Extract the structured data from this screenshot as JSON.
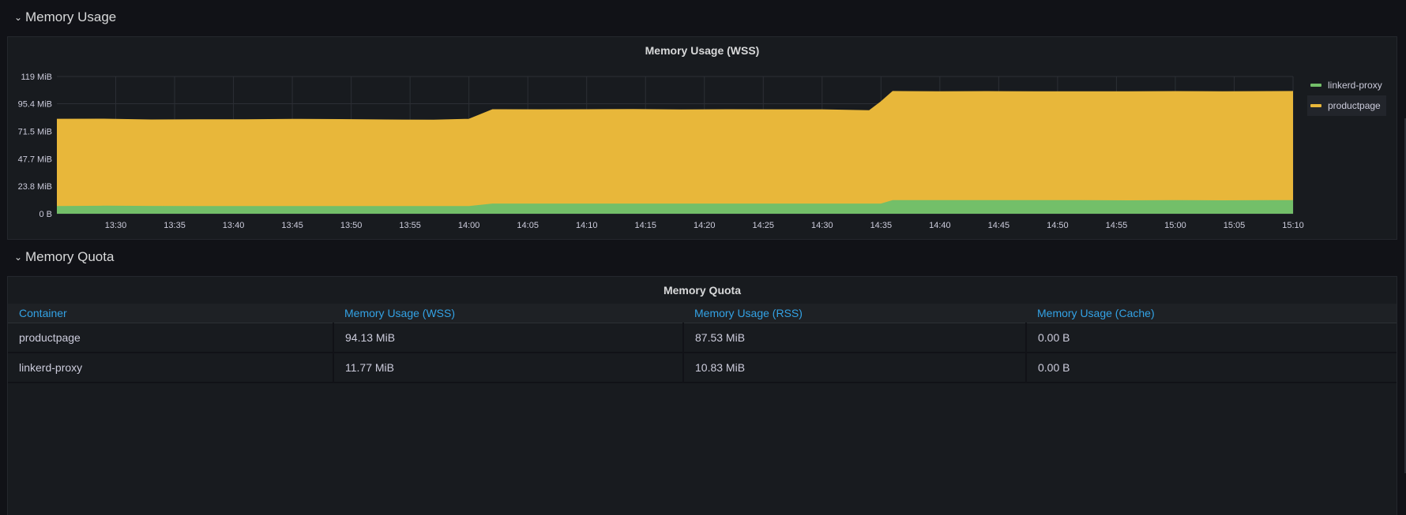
{
  "rows": {
    "memory_usage": {
      "title": "Memory Usage"
    },
    "memory_quota": {
      "title": "Memory Quota"
    }
  },
  "icons": {
    "collapse": "chevron-down-icon"
  },
  "colors": {
    "background": "#111217",
    "panel": "#181b1f",
    "linkerd_proxy": "#73bf69",
    "productpage": "#e8b73a",
    "header_link": "#33a2e5"
  },
  "chart_panel": {
    "title": "Memory Usage (WSS)"
  },
  "legend": {
    "items": [
      {
        "label": "linkerd-proxy",
        "color": "#73bf69"
      },
      {
        "label": "productpage",
        "color": "#e8b73a"
      }
    ]
  },
  "chart_data": {
    "type": "area",
    "stacked": true,
    "title": "Memory Usage (WSS)",
    "y_unit": "MiB",
    "ylim": [
      0,
      119
    ],
    "y_ticks": [
      {
        "value": 0,
        "label": "0 B"
      },
      {
        "value": 23.8,
        "label": "23.8 MiB"
      },
      {
        "value": 47.7,
        "label": "47.7 MiB"
      },
      {
        "value": 71.5,
        "label": "71.5 MiB"
      },
      {
        "value": 95.4,
        "label": "95.4 MiB"
      },
      {
        "value": 119,
        "label": "119 MiB"
      }
    ],
    "x_minutes_range": [
      805,
      910
    ],
    "x_ticks": [
      {
        "minute": 810,
        "label": "13:30"
      },
      {
        "minute": 815,
        "label": "13:35"
      },
      {
        "minute": 820,
        "label": "13:40"
      },
      {
        "minute": 825,
        "label": "13:45"
      },
      {
        "minute": 830,
        "label": "13:50"
      },
      {
        "minute": 835,
        "label": "13:55"
      },
      {
        "minute": 840,
        "label": "14:00"
      },
      {
        "minute": 845,
        "label": "14:05"
      },
      {
        "minute": 850,
        "label": "14:10"
      },
      {
        "minute": 855,
        "label": "14:15"
      },
      {
        "minute": 860,
        "label": "14:20"
      },
      {
        "minute": 865,
        "label": "14:25"
      },
      {
        "minute": 870,
        "label": "14:30"
      },
      {
        "minute": 875,
        "label": "14:35"
      },
      {
        "minute": 880,
        "label": "14:40"
      },
      {
        "minute": 885,
        "label": "14:45"
      },
      {
        "minute": 890,
        "label": "14:50"
      },
      {
        "minute": 895,
        "label": "14:55"
      },
      {
        "minute": 900,
        "label": "15:00"
      },
      {
        "minute": 905,
        "label": "15:05"
      },
      {
        "minute": 910,
        "label": "15:10"
      }
    ],
    "x": [
      805,
      809,
      813,
      817,
      821,
      825,
      829,
      833,
      837,
      840,
      842,
      846,
      850,
      854,
      858,
      862,
      866,
      870,
      874,
      875,
      876,
      880,
      884,
      888,
      892,
      896,
      900,
      904,
      908,
      910
    ],
    "series": [
      {
        "name": "linkerd-proxy",
        "color": "#73bf69",
        "values": [
          6.6,
          7.0,
          6.8,
          6.7,
          6.6,
          6.6,
          6.7,
          6.6,
          6.6,
          6.6,
          8.8,
          8.8,
          8.8,
          8.8,
          8.8,
          8.8,
          8.8,
          8.8,
          8.8,
          8.8,
          11.8,
          11.8,
          11.8,
          11.8,
          11.8,
          11.6,
          11.8,
          11.6,
          11.8,
          11.8
        ]
      },
      {
        "name": "productpage",
        "color": "#e8b73a",
        "values": [
          75.4,
          75.1,
          74.6,
          74.9,
          74.9,
          75.3,
          75.0,
          74.8,
          74.6,
          75.4,
          81.5,
          81.4,
          81.5,
          81.6,
          81.3,
          81.5,
          81.4,
          81.4,
          80.6,
          88.3,
          94.3,
          94.1,
          94.2,
          94.0,
          94.1,
          94.3,
          94.2,
          94.2,
          94.2,
          94.3
        ]
      }
    ]
  },
  "quota_panel": {
    "title": "Memory Quota",
    "columns": [
      "Container",
      "Memory Usage (WSS)",
      "Memory Usage (RSS)",
      "Memory Usage (Cache)"
    ],
    "rows": [
      [
        "productpage",
        "94.13 MiB",
        "87.53 MiB",
        "0.00 B"
      ],
      [
        "linkerd-proxy",
        "11.77 MiB",
        "10.83 MiB",
        "0.00 B"
      ]
    ]
  }
}
